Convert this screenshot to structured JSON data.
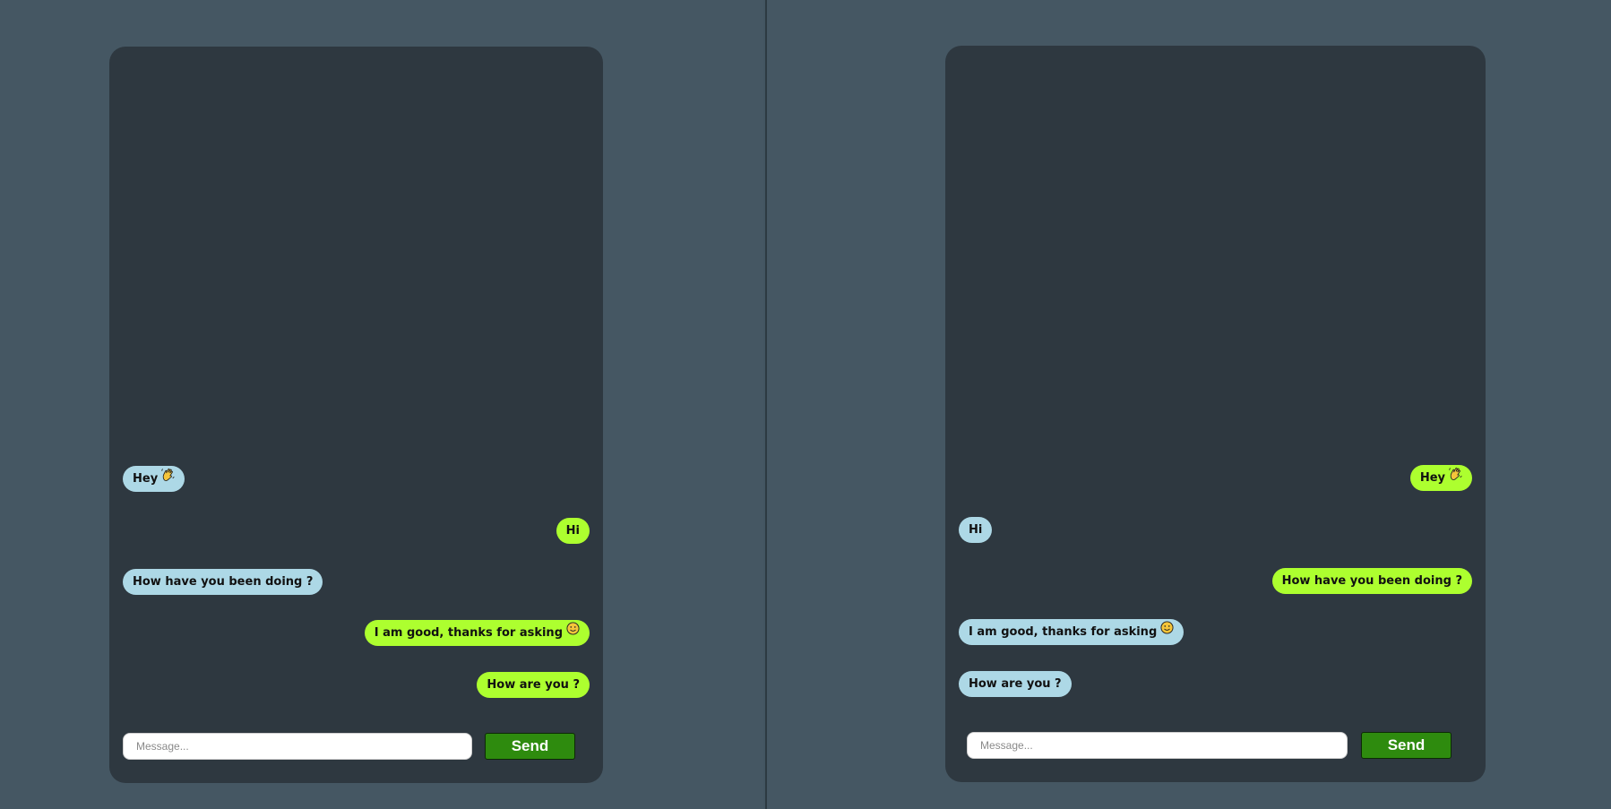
{
  "left_chat": {
    "messages": [
      {
        "text": "Hey",
        "emoji": "waving-hand-icon",
        "side": "left",
        "color": "#add8e6"
      },
      {
        "text": "Hi",
        "side": "right",
        "color": "#adff2f"
      },
      {
        "text": "How have you been doing ?",
        "side": "left",
        "color": "#add8e6"
      },
      {
        "text": "I am good, thanks for asking",
        "emoji": "smiley-icon",
        "side": "right",
        "color": "#adff2f"
      },
      {
        "text": "How are you ?",
        "side": "right",
        "color": "#adff2f"
      }
    ],
    "input_placeholder": "Message...",
    "send_label": "Send"
  },
  "right_chat": {
    "messages": [
      {
        "text": "Hey",
        "emoji": "waving-hand-icon",
        "side": "right",
        "color": "#adff2f"
      },
      {
        "text": "Hi",
        "side": "left",
        "color": "#add8e6"
      },
      {
        "text": "How have you been doing ?",
        "side": "right",
        "color": "#adff2f"
      },
      {
        "text": "I am good, thanks for asking",
        "emoji": "smiley-icon",
        "side": "left",
        "color": "#add8e6"
      },
      {
        "text": "How are you ?",
        "side": "left",
        "color": "#add8e6"
      }
    ],
    "input_placeholder": "Message...",
    "send_label": "Send"
  },
  "colors": {
    "background": "#455763",
    "panel": "#2e3840",
    "incoming_bubble": "#add8e6",
    "outgoing_bubble": "#adff2f",
    "send_button": "#2e8b0e"
  }
}
